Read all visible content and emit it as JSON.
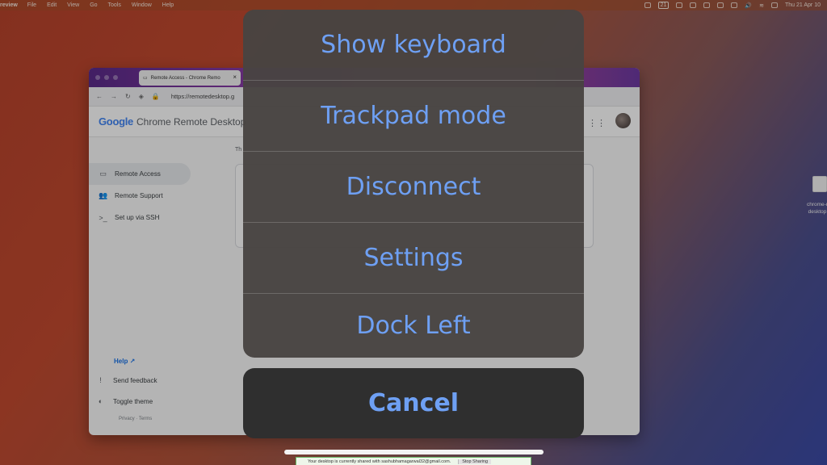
{
  "menubar": {
    "app": "review",
    "items": [
      "File",
      "Edit",
      "View",
      "Go",
      "Tools",
      "Window",
      "Help"
    ],
    "badge": "21",
    "clock": "Thu 21 Apr 10"
  },
  "browser": {
    "tab_title": "Remote Access - Chrome Remo",
    "url": "https://remotedesktop.g",
    "header_logo": "Google",
    "header_title": "Chrome Remote Desktop",
    "partial_text": "Th",
    "nav": [
      "Remote Access",
      "Remote Support",
      "Set up via SSH"
    ],
    "help": "Help",
    "send_feedback": "Send feedback",
    "toggle_theme": "Toggle theme",
    "legal": "Privacy · Terms"
  },
  "desktop_file": {
    "name_line1": "chrome-r",
    "name_line2": "desktop"
  },
  "action_sheet": {
    "options": [
      "Show keyboard",
      "Trackpad mode",
      "Disconnect",
      "Settings",
      "Dock Left"
    ],
    "cancel": "Cancel",
    "accent_color": "#6ea0f4"
  },
  "sharing_bar": {
    "message": "Your desktop is currently shared with sashubhamagarwal32@gmail.com.",
    "stop": "Stop Sharing"
  }
}
